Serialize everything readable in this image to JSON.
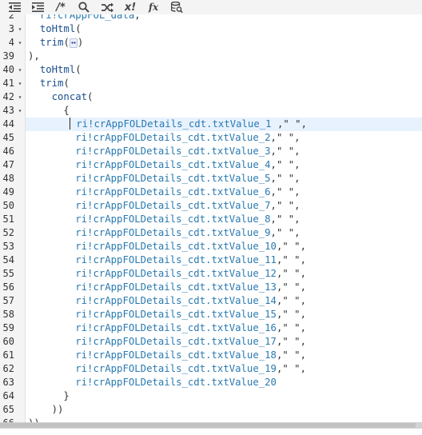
{
  "toolbar": {
    "buttons": [
      {
        "name": "outdent-button",
        "icon": "outdent-icon",
        "label": ""
      },
      {
        "name": "indent-button",
        "icon": "indent-icon",
        "label": ""
      },
      {
        "name": "comment-button",
        "icon": "comment-icon",
        "label": "/*"
      },
      {
        "name": "search-button",
        "icon": "search-icon",
        "label": ""
      },
      {
        "name": "random-button",
        "icon": "shuffle-icon",
        "label": ""
      },
      {
        "name": "expression-rule-button",
        "icon": "x-bang-icon",
        "label": "x!"
      },
      {
        "name": "function-button",
        "icon": "function-icon",
        "label": "fx"
      },
      {
        "name": "query-button",
        "icon": "database-search-icon",
        "label": ""
      }
    ]
  },
  "editor": {
    "active_line": 44,
    "lines": [
      {
        "num": "2",
        "fold": "",
        "code": "  ri!crAppFOL_data,"
      },
      {
        "num": "3",
        "fold": "▾",
        "code": "  toHtml("
      },
      {
        "num": "4",
        "fold": "▾",
        "code": "  trim("
      },
      {
        "num": "39",
        "fold": "",
        "code": "),"
      },
      {
        "num": "40",
        "fold": "▾",
        "code": "  toHtml("
      },
      {
        "num": "41",
        "fold": "▾",
        "code": "  trim("
      },
      {
        "num": "42",
        "fold": "▾",
        "code": "    concat("
      },
      {
        "num": "43",
        "fold": "▾",
        "code": "      {"
      },
      {
        "num": "44",
        "fold": "",
        "code": "ri!crAppFOLDetails_cdt.txtValue_1 ,\" \","
      },
      {
        "num": "45",
        "fold": "",
        "code": "ri!crAppFOLDetails_cdt.txtValue_2,\" \","
      },
      {
        "num": "46",
        "fold": "",
        "code": "ri!crAppFOLDetails_cdt.txtValue_3,\" \","
      },
      {
        "num": "47",
        "fold": "",
        "code": "ri!crAppFOLDetails_cdt.txtValue_4,\" \","
      },
      {
        "num": "48",
        "fold": "",
        "code": "ri!crAppFOLDetails_cdt.txtValue_5,\" \","
      },
      {
        "num": "49",
        "fold": "",
        "code": "ri!crAppFOLDetails_cdt.txtValue_6,\" \","
      },
      {
        "num": "50",
        "fold": "",
        "code": "ri!crAppFOLDetails_cdt.txtValue_7,\" \","
      },
      {
        "num": "51",
        "fold": "",
        "code": "ri!crAppFOLDetails_cdt.txtValue_8,\" \","
      },
      {
        "num": "52",
        "fold": "",
        "code": "ri!crAppFOLDetails_cdt.txtValue_9,\" \","
      },
      {
        "num": "53",
        "fold": "",
        "code": "ri!crAppFOLDetails_cdt.txtValue_10,\" \","
      },
      {
        "num": "54",
        "fold": "",
        "code": "ri!crAppFOLDetails_cdt.txtValue_11,\" \","
      },
      {
        "num": "55",
        "fold": "",
        "code": "ri!crAppFOLDetails_cdt.txtValue_12,\" \","
      },
      {
        "num": "56",
        "fold": "",
        "code": "ri!crAppFOLDetails_cdt.txtValue_13,\" \","
      },
      {
        "num": "57",
        "fold": "",
        "code": "ri!crAppFOLDetails_cdt.txtValue_14,\" \","
      },
      {
        "num": "58",
        "fold": "",
        "code": "ri!crAppFOLDetails_cdt.txtValue_15,\" \","
      },
      {
        "num": "59",
        "fold": "",
        "code": "ri!crAppFOLDetails_cdt.txtValue_16,\" \","
      },
      {
        "num": "60",
        "fold": "",
        "code": "ri!crAppFOLDetails_cdt.txtValue_17,\" \","
      },
      {
        "num": "61",
        "fold": "",
        "code": "ri!crAppFOLDetails_cdt.txtValue_18,\" \","
      },
      {
        "num": "62",
        "fold": "",
        "code": "ri!crAppFOLDetails_cdt.txtValue_19,\" \","
      },
      {
        "num": "63",
        "fold": "",
        "code": "ri!crAppFOLDetails_cdt.txtValue_20"
      },
      {
        "num": "64",
        "fold": "",
        "code": "      }"
      },
      {
        "num": "65",
        "fold": "",
        "code": "    ))"
      },
      {
        "num": "66",
        "fold": "",
        "code": "))"
      }
    ],
    "collapsed_marker": "↔"
  },
  "colors": {
    "function": "#1a4f8c",
    "variable": "#2a7ab0",
    "active_line": "#e8f2ff",
    "gutter": "#f4f4f4"
  }
}
